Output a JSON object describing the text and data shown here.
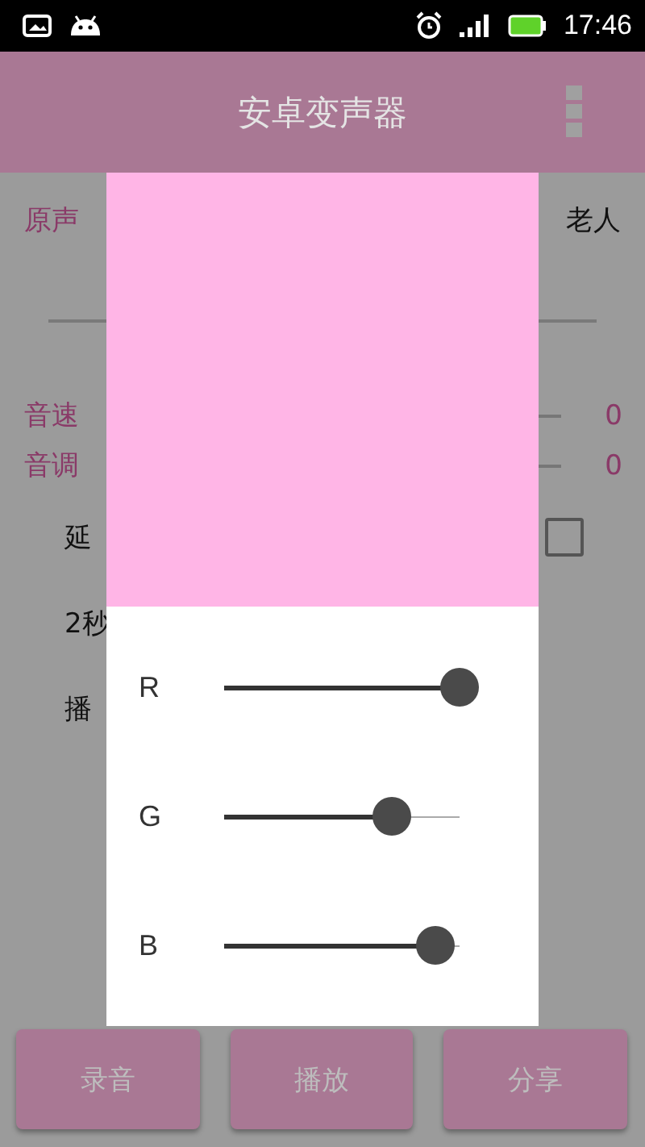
{
  "status_bar": {
    "time": "17:46"
  },
  "app_bar": {
    "title": "安卓变声器"
  },
  "voice_options": [
    {
      "label": "原声",
      "selected": true
    },
    {
      "label": "老人",
      "selected": false
    }
  ],
  "adjustments": [
    {
      "label": "音速",
      "value": "0"
    },
    {
      "label": "音调",
      "value": "0"
    }
  ],
  "options": [
    {
      "label": "延",
      "kind": "checkbox",
      "checked": false
    },
    {
      "label": "2秒",
      "kind": "text"
    },
    {
      "label": "播",
      "kind": "text"
    }
  ],
  "dialog": {
    "channels": [
      {
        "label": "R",
        "level": 1.0
      },
      {
        "label": "G",
        "level": 0.71
      },
      {
        "label": "B",
        "level": 0.9
      }
    ]
  },
  "buttons": [
    {
      "label": "录音"
    },
    {
      "label": "播放"
    },
    {
      "label": "分享"
    }
  ]
}
